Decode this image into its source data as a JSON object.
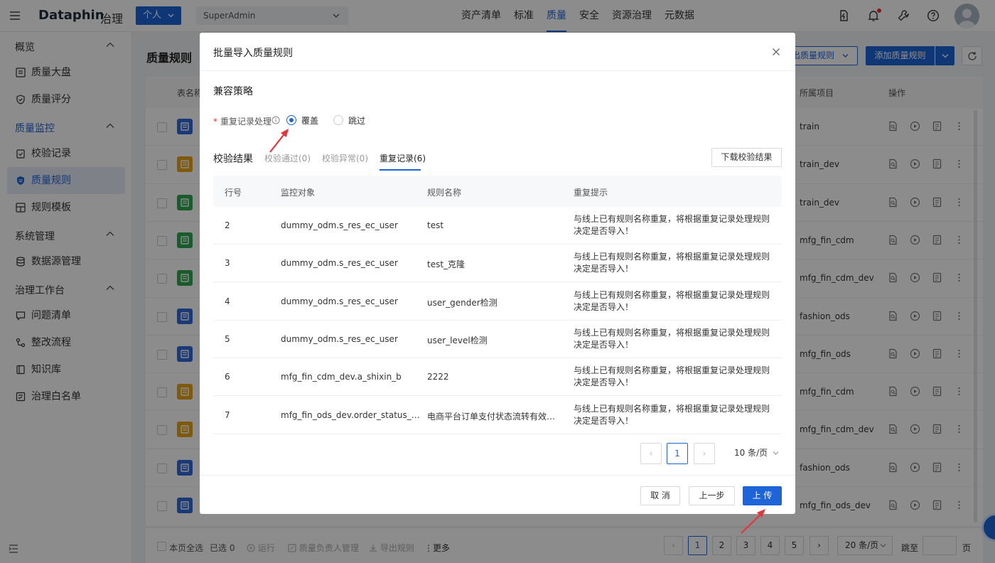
{
  "app": {
    "logo": "Dataphin",
    "logo_sub": "治理",
    "personal_label": "个人",
    "tenant": "SuperAdmin"
  },
  "nav": [
    {
      "label": "资产清单"
    },
    {
      "label": "标准"
    },
    {
      "label": "质量",
      "active": true
    },
    {
      "label": "安全"
    },
    {
      "label": "资源治理"
    },
    {
      "label": "元数据"
    }
  ],
  "sidebar": {
    "overview": "概览",
    "quality_dashboard": "质量大盘",
    "quality_score": "质量评分",
    "quality_monitor": "质量监控",
    "check_records": "校验记录",
    "quality_rules": "质量规则",
    "rule_templates": "规则模板",
    "system_mgmt": "系统管理",
    "datasource_mgmt": "数据源管理",
    "governance_bench": "治理工作台",
    "issue_list": "问题清单",
    "rectify_flow": "整改流程",
    "knowledge_base": "知识库",
    "whitelist": "治理白名单"
  },
  "page": {
    "title": "质量规则",
    "export_label": "出质量规则",
    "add_label": "添加质量规则",
    "columns": {
      "table_name": "表名称",
      "project": "所属项目",
      "actions": "操作"
    },
    "rows": [
      {
        "project": "train",
        "icon_color": "#2f6bd8"
      },
      {
        "project": "train_dev",
        "icon_color": "#e8a317"
      },
      {
        "project": "train_dev",
        "icon_color": "#2fa84f"
      },
      {
        "project": "mfg_fin_cdm",
        "icon_color": "#2fa84f"
      },
      {
        "project": "mfg_fin_cdm_dev",
        "icon_color": "#2fa84f"
      },
      {
        "project": "fashion_ods",
        "icon_color": "#2f6bd8"
      },
      {
        "project": "mfg_fin_ods",
        "icon_color": "#2f6bd8"
      },
      {
        "project": "mfg_fin_cdm",
        "icon_color": "#e8a317"
      },
      {
        "project": "mfg_fin_cdm_dev",
        "icon_color": "#e8a317"
      },
      {
        "project": "fashion_ods",
        "icon_color": "#2f6bd8"
      },
      {
        "project": "mfg_fin_ods_dev",
        "icon_color": "#2f6bd8"
      }
    ],
    "footer": {
      "select_all": "本页全选",
      "selected": "已选 0",
      "run": "运行",
      "owner_mgmt": "质量负责人管理",
      "export_rules": "导出规则",
      "more": "更多",
      "pages": [
        "1",
        "2",
        "3",
        "4",
        "5"
      ],
      "page_size": "20 条/页",
      "jump_label": "跳至",
      "page_unit": "页"
    }
  },
  "modal": {
    "title": "批量导入质量规则",
    "section_title": "兼容策略",
    "required_mark": "*",
    "strategy_label": "重复记录处理",
    "option_overwrite": "覆盖",
    "option_skip": "跳过",
    "result_title": "校验结果",
    "tabs": [
      "校验通过(0)",
      "校验异常(0)",
      "重复记录(6)"
    ],
    "download_label": "下载校验结果",
    "columns": {
      "row_no": "行号",
      "monitor_object": "监控对象",
      "rule_name": "规则名称",
      "repeat_hint": "重复提示"
    },
    "records": [
      {
        "row_no": "2",
        "monitor_object": "dummy_odm.s_res_ec_user",
        "rule_name": "test",
        "repeat_hint": "与线上已有规则名称重复，将根据重复记录处理规则决定是否导入！"
      },
      {
        "row_no": "3",
        "monitor_object": "dummy_odm.s_res_ec_user",
        "rule_name": "test_克隆",
        "repeat_hint": "与线上已有规则名称重复，将根据重复记录处理规则决定是否导入！"
      },
      {
        "row_no": "4",
        "monitor_object": "dummy_odm.s_res_ec_user",
        "rule_name": "user_gender检测",
        "repeat_hint": "与线上已有规则名称重复，将根据重复记录处理规则决定是否导入！"
      },
      {
        "row_no": "5",
        "monitor_object": "dummy_odm.s_res_ec_user",
        "rule_name": "user_level检测",
        "repeat_hint": "与线上已有规则名称重复，将根据重复记录处理规则决定是否导入！"
      },
      {
        "row_no": "6",
        "monitor_object": "mfg_fin_cdm_dev.a_shixin_b",
        "rule_name": "2222",
        "repeat_hint": "与线上已有规则名称重复，将根据重复记录处理规则决定是否导入！"
      },
      {
        "row_no": "7",
        "monitor_object": "mfg_fin_ods_dev.order_status_…",
        "rule_name": "电商平台订单支付状态流转有效…",
        "repeat_hint": "与线上已有规则名称重复，将根据重复记录处理规则决定是否导入！"
      }
    ],
    "current_page": "1",
    "page_size": "10 条/页",
    "cancel_label": "取 消",
    "prev_label": "上一步",
    "upload_label": "上 传"
  },
  "colors": {
    "primary": "#1d64d8",
    "annotation_arrow": "#e6343a"
  }
}
